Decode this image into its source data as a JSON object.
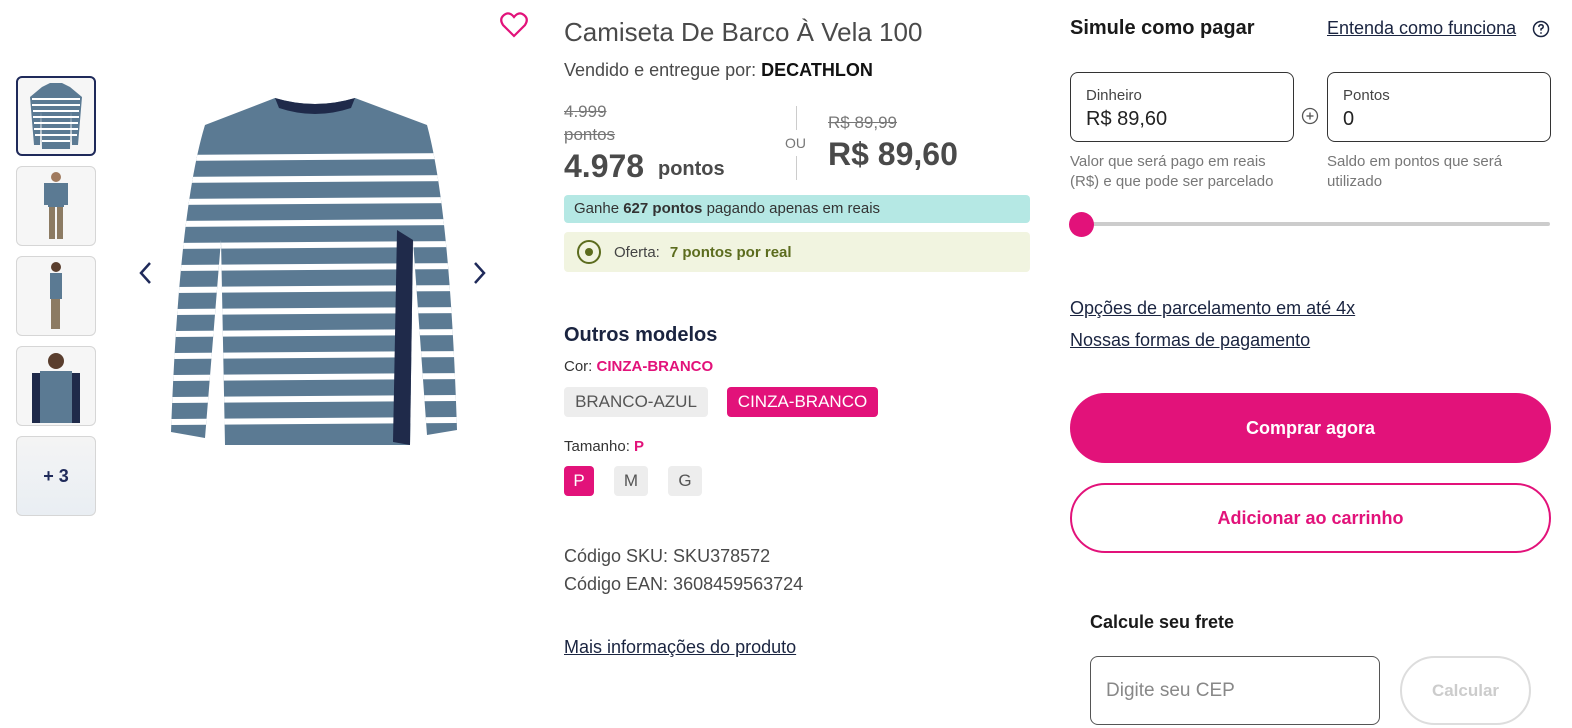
{
  "product": {
    "title": "Camiseta De Barco À Vela 100",
    "seller_prefix": "Vendido e entregue por:",
    "seller_name": "DECATHLON",
    "old_points": "4.999 pontos",
    "points": "4.978",
    "points_unit": "pontos",
    "or_label": "OU",
    "old_price": "R$ 89,99",
    "price": "R$ 89,60",
    "earn_prefix": "Ganhe",
    "earn_points": "627 pontos",
    "earn_suffix": "pagando apenas em reais",
    "offer_label": "Oferta:",
    "offer_value": "7 pontos por real"
  },
  "gallery": {
    "more_label": "+ 3"
  },
  "variants": {
    "title": "Outros modelos",
    "color_label": "Cor:",
    "color_selected": "CINZA-BRANCO",
    "colors": [
      "BRANCO-AZUL",
      "CINZA-BRANCO"
    ],
    "size_label": "Tamanho:",
    "size_selected": "P",
    "sizes": [
      "P",
      "M",
      "G"
    ]
  },
  "codes": {
    "sku": "Código SKU: SKU378572",
    "ean": "Código EAN: 3608459563724"
  },
  "more_info_link": "Mais informações do produto",
  "simulator": {
    "title": "Simule como pagar",
    "help_link": "Entenda como funciona",
    "money_label": "Dinheiro",
    "money_value": "R$ 89,60",
    "points_label": "Pontos",
    "points_value": "0",
    "money_help": "Valor que será pago em reais (R$) e que pode ser parcelado",
    "points_help": "Saldo em pontos que será utilizado",
    "slider_points_fraction": 0
  },
  "links": {
    "installments": "Opções de parcelamento em até 4x",
    "payment_methods": "Nossas formas de pagamento"
  },
  "actions": {
    "buy_now": "Comprar agora",
    "add_to_cart": "Adicionar ao carrinho"
  },
  "shipping": {
    "title": "Calcule seu frete",
    "cep_placeholder": "Digite seu CEP",
    "calculate": "Calcular"
  },
  "colors": {
    "accent": "#e2127a",
    "earn_bg": "#b5e8e4",
    "offer_bg": "#f1f4e0",
    "navy": "#1a2440"
  }
}
